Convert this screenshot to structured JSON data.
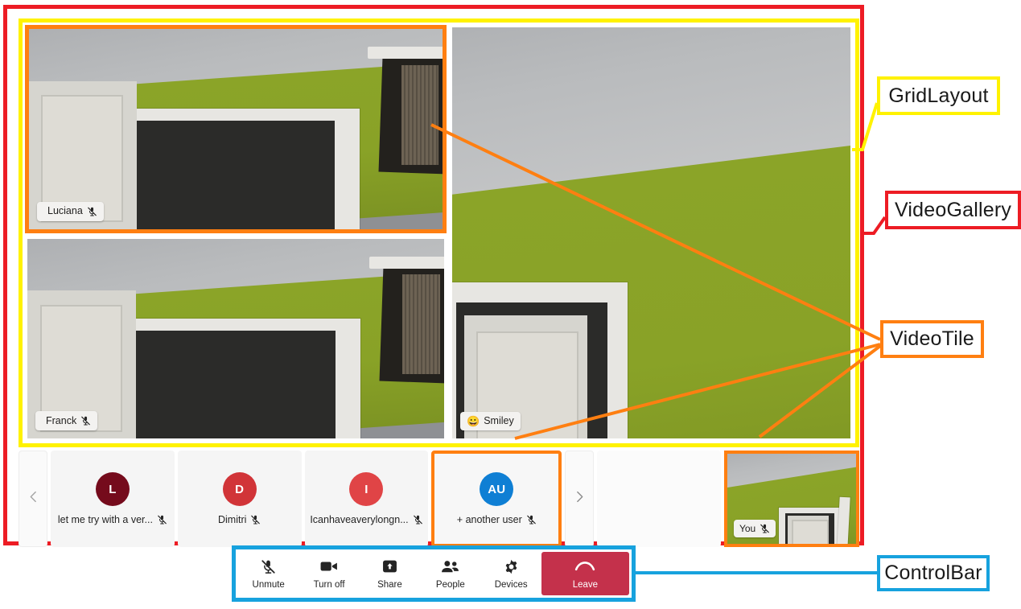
{
  "annotations": [
    {
      "id": "gridlayout",
      "label": "GridLayout",
      "color": "#FFF200"
    },
    {
      "id": "videogallery",
      "label": "VideoGallery",
      "color": "#ED1C24"
    },
    {
      "id": "videotile",
      "label": "VideoTile",
      "color": "#FF7F11"
    },
    {
      "id": "controlbar",
      "label": "ControlBar",
      "color": "#17A2DE"
    }
  ],
  "gallery": {
    "grid_tiles": [
      {
        "name": "Luciana",
        "muted": true,
        "highlighted": true,
        "emoji": ""
      },
      {
        "name": "Franck",
        "muted": true,
        "highlighted": false,
        "emoji": ""
      },
      {
        "name": "Smiley",
        "muted": false,
        "highlighted": false,
        "emoji": "😀"
      }
    ],
    "overflow": {
      "scroll_left_icon": "chevron-left-icon",
      "scroll_right_icon": "chevron-right-icon",
      "participants": [
        {
          "initials": "L",
          "label": "let me try with a ver...",
          "avatar_color": "#750B1C",
          "muted": true,
          "highlighted": false
        },
        {
          "initials": "D",
          "label": "Dimitri",
          "avatar_color": "#D13438",
          "muted": true,
          "highlighted": false
        },
        {
          "initials": "I",
          "label": "Icanhaveaverylongn...",
          "avatar_color": "#E04446",
          "muted": true,
          "highlighted": false
        },
        {
          "initials": "AU",
          "label": "+ another user",
          "avatar_color": "#0F7FD4",
          "muted": true,
          "highlighted": true
        },
        {
          "initials": "",
          "label": "",
          "avatar_color": "",
          "muted": false,
          "highlighted": false
        }
      ],
      "self_tile": {
        "name": "You",
        "muted": true,
        "highlighted": true
      }
    }
  },
  "control_bar": {
    "buttons": [
      {
        "label": "Unmute",
        "icon": "microphone-off-icon",
        "kind": "normal"
      },
      {
        "label": "Turn off",
        "icon": "camera-icon",
        "kind": "normal"
      },
      {
        "label": "Share",
        "icon": "share-screen-icon",
        "kind": "normal"
      },
      {
        "label": "People",
        "icon": "people-icon",
        "kind": "normal"
      },
      {
        "label": "Devices",
        "icon": "gear-icon",
        "kind": "normal"
      },
      {
        "label": "Leave",
        "icon": "end-call-icon",
        "kind": "danger"
      }
    ],
    "danger_color": "#C4314B"
  }
}
